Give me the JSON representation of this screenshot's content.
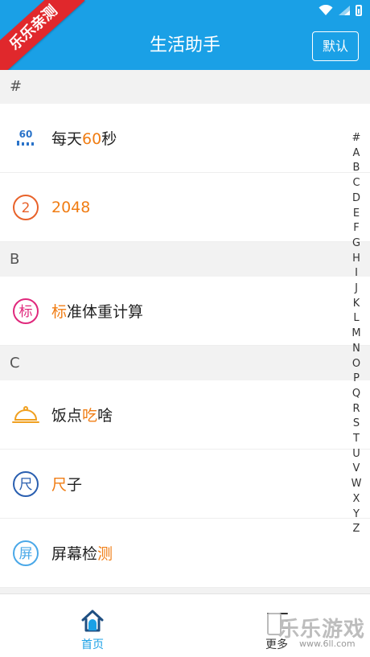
{
  "header": {
    "title": "生活助手",
    "default_button": "默认"
  },
  "ribbon": {
    "text": "乐乐亲测"
  },
  "sections": [
    {
      "letter": "#",
      "items": [
        {
          "label_parts": [
            "每天",
            "60",
            "秒"
          ],
          "icon": "sixty-seconds-icon"
        },
        {
          "label_parts": [
            "",
            "2048",
            ""
          ],
          "icon": "number-2-circle-icon"
        }
      ]
    },
    {
      "letter": "B",
      "items": [
        {
          "label_parts": [
            "",
            "标",
            "准体重计算"
          ],
          "icon": "biao-circle-icon"
        }
      ]
    },
    {
      "letter": "C",
      "items": [
        {
          "label_parts": [
            "饭点",
            "吃",
            "啥"
          ],
          "icon": "food-cloche-icon"
        },
        {
          "label_parts": [
            "",
            "尺",
            "子"
          ],
          "icon": "chi-circle-icon"
        },
        {
          "label_parts": [
            "屏幕检",
            "测",
            ""
          ],
          "icon": "ping-circle-icon"
        }
      ]
    }
  ],
  "icons": {
    "sixty": "60",
    "two": "2",
    "biao": "标",
    "chi": "尺",
    "ping": "屏"
  },
  "alphabet_index": [
    "#",
    "A",
    "B",
    "C",
    "D",
    "E",
    "F",
    "G",
    "H",
    "I",
    "J",
    "K",
    "L",
    "M",
    "N",
    "O",
    "P",
    "Q",
    "R",
    "S",
    "T",
    "U",
    "V",
    "W",
    "X",
    "Y",
    "Z"
  ],
  "bottom_nav": {
    "home": "首页",
    "more": "更多"
  },
  "watermark": {
    "main": "乐乐游戏",
    "sub": "www.6ll.com"
  },
  "colors": {
    "primary": "#1aa0e6",
    "highlight": "#f07d14",
    "ribbon": "#e0282c"
  }
}
